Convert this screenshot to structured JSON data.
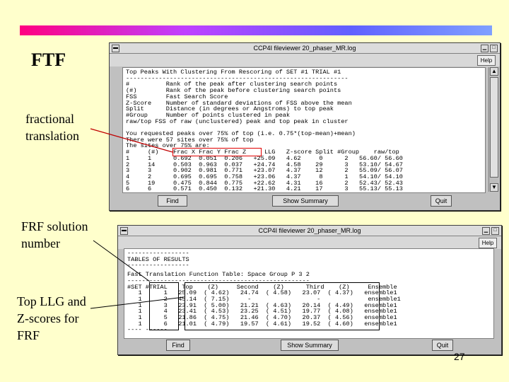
{
  "slide": {
    "title": "FTF",
    "label_fractional": "fractional\ntranslation",
    "label_frf": "FRF solution\nnumber",
    "label_llg": "Top LLG and\nZ-scores for\nFRF",
    "page_number": "27"
  },
  "colors": {
    "background": "#ffffcc",
    "highlight": "#e00000",
    "table_red": "#b00000"
  },
  "window1": {
    "title": "CCP4I fileviewer 20_phaser_MR.log",
    "help_label": "Help",
    "find_label": "Find",
    "summary_label": "Show Summary",
    "quit_label": "Quit",
    "text": "Top Peaks With Clustering From Rescoring of SET #1 TRIAL #1\n-------------------------------------------------------------\n#          Rank of the peak after clustering search points\n(#)        Rank of the peak before clustering search points\nFSS        Fast Search Score\nZ-Score    Number of standard deviations of FSS above the mean\nSplit      Distance (in degrees or Angstroms) to top peak\n#Group     Number of points clustered in peak\nraw/top FSS of raw (unclustered) peak and top peak in cluster\n\nYou requested peaks over 75% of top (i.e. 0.75*(top-mean)+mean)\nThere were 57 sites over 75% of top\nThe sites over 75% are:\n#     (#)    Frac X Frac Y Frac Z     LLG   Z-score Split #Group    raw/top\n1     1      0.692  0.051  0.206   +25.09   4.62     0      2   56.60/ 56.60\n2     14     0.503  0.963  0.037   +24.74   4.58    29      3   53.10/ 54.67\n3     3      0.902  0.981  0.771   +23.07   4.37    12      2   55.09/ 56.07\n4     2      0.695  0.695  0.758   +23.06   4.37     8      1   54.10/ 54.10\n5     19     0.475  0.844  0.775   +22.62   4.31    16      2   52.43/ 52.43\n6     6      0.571  0.450  0.132   +21.30   4.21    17      3   55.13/ 55.13"
  },
  "window2": {
    "title": "CCP4I fileviewer 20_phaser_MR.log",
    "help_label": "Help",
    "find_label": "Find",
    "summary_label": "Show Summary",
    "quit_label": "Quit",
    "text_header": "-----------------\nTABLES OF RESULTS\n-----------------",
    "text_table": "Fast Translation Function Table: Space Group P 3 2\n--------------------------------------------------\n#SET #TRIAL    Top    (Z)     Second    (Z)      Third    (Z)     Ensemble\n   1      1   25.09  ( 4.62)   24.74  ( 4.58)   23.07  ( 4.37)   ensemble1\n   1      2   45.14  ( 7.15)     -                  -             ensemble1\n   1      3   23.91  ( 5.00)   21.21  ( 4.63)   20.14  ( 4.49)   ensemble1\n   1      4   23.41  ( 4.53)   23.25  ( 4.51)   19.77  ( 4.08)   ensemble1\n   1      5   21.86  ( 4.75)   21.46  ( 4.70)   20.37  ( 4.56)   ensemble1\n   1      6   21.01  ( 4.79)   19.57  ( 4.61)   19.52  ( 4.60)   ensemble1\n---- ------"
  }
}
